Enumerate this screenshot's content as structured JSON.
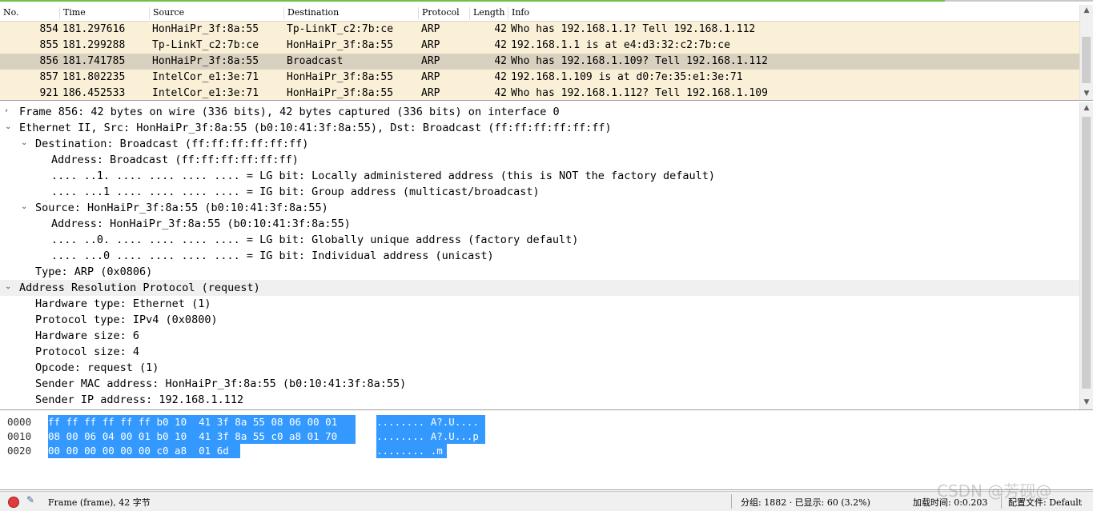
{
  "packet_list": {
    "columns": [
      "No.",
      "Time",
      "Source",
      "Destination",
      "Protocol",
      "Length",
      "Info"
    ],
    "rows": [
      {
        "no": "854",
        "time": "181.297616",
        "src": "HonHaiPr_3f:8a:55",
        "dst": "Tp-LinkT_c2:7b:ce",
        "proto": "ARP",
        "len": "42",
        "info": "Who has 192.168.1.1? Tell 192.168.1.112",
        "selected": false
      },
      {
        "no": "855",
        "time": "181.299288",
        "src": "Tp-LinkT_c2:7b:ce",
        "dst": "HonHaiPr_3f:8a:55",
        "proto": "ARP",
        "len": "42",
        "info": "192.168.1.1 is at e4:d3:32:c2:7b:ce",
        "selected": false
      },
      {
        "no": "856",
        "time": "181.741785",
        "src": "HonHaiPr_3f:8a:55",
        "dst": "Broadcast",
        "proto": "ARP",
        "len": "42",
        "info": "Who has 192.168.1.109? Tell 192.168.1.112",
        "selected": true
      },
      {
        "no": "857",
        "time": "181.802235",
        "src": "IntelCor_e1:3e:71",
        "dst": "HonHaiPr_3f:8a:55",
        "proto": "ARP",
        "len": "42",
        "info": "192.168.1.109 is at d0:7e:35:e1:3e:71",
        "selected": false
      },
      {
        "no": "921",
        "time": "186.452533",
        "src": "IntelCor_e1:3e:71",
        "dst": "HonHaiPr_3f:8a:55",
        "proto": "ARP",
        "len": "42",
        "info": "Who has 192.168.1.112? Tell 192.168.1.109",
        "selected": false
      }
    ]
  },
  "details": [
    {
      "indent": 0,
      "toggle": "collapsed",
      "text": "Frame 856: 42 bytes on wire (336 bits), 42 bytes captured (336 bits) on interface 0",
      "highlight": false
    },
    {
      "indent": 0,
      "toggle": "expanded",
      "text": "Ethernet II, Src: HonHaiPr_3f:8a:55 (b0:10:41:3f:8a:55), Dst: Broadcast (ff:ff:ff:ff:ff:ff)",
      "highlight": false
    },
    {
      "indent": 1,
      "toggle": "expanded",
      "text": "Destination: Broadcast (ff:ff:ff:ff:ff:ff)",
      "highlight": false
    },
    {
      "indent": 2,
      "toggle": "none",
      "text": "Address: Broadcast (ff:ff:ff:ff:ff:ff)",
      "highlight": false
    },
    {
      "indent": 2,
      "toggle": "none",
      "text": ".... ..1. .... .... .... .... = LG bit: Locally administered address (this is NOT the factory default)",
      "highlight": false
    },
    {
      "indent": 2,
      "toggle": "none",
      "text": ".... ...1 .... .... .... .... = IG bit: Group address (multicast/broadcast)",
      "highlight": false
    },
    {
      "indent": 1,
      "toggle": "expanded",
      "text": "Source: HonHaiPr_3f:8a:55 (b0:10:41:3f:8a:55)",
      "highlight": false
    },
    {
      "indent": 2,
      "toggle": "none",
      "text": "Address: HonHaiPr_3f:8a:55 (b0:10:41:3f:8a:55)",
      "highlight": false
    },
    {
      "indent": 2,
      "toggle": "none",
      "text": ".... ..0. .... .... .... .... = LG bit: Globally unique address (factory default)",
      "highlight": false
    },
    {
      "indent": 2,
      "toggle": "none",
      "text": ".... ...0 .... .... .... .... = IG bit: Individual address (unicast)",
      "highlight": false
    },
    {
      "indent": 1,
      "toggle": "none",
      "text": "Type: ARP (0x0806)",
      "highlight": false
    },
    {
      "indent": 0,
      "toggle": "expanded",
      "text": "Address Resolution Protocol (request)",
      "highlight": true
    },
    {
      "indent": 1,
      "toggle": "none",
      "text": "Hardware type: Ethernet (1)",
      "highlight": false
    },
    {
      "indent": 1,
      "toggle": "none",
      "text": "Protocol type: IPv4 (0x0800)",
      "highlight": false
    },
    {
      "indent": 1,
      "toggle": "none",
      "text": "Hardware size: 6",
      "highlight": false
    },
    {
      "indent": 1,
      "toggle": "none",
      "text": "Protocol size: 4",
      "highlight": false
    },
    {
      "indent": 1,
      "toggle": "none",
      "text": "Opcode: request (1)",
      "highlight": false
    },
    {
      "indent": 1,
      "toggle": "none",
      "text": "Sender MAC address: HonHaiPr_3f:8a:55 (b0:10:41:3f:8a:55)",
      "highlight": false
    },
    {
      "indent": 1,
      "toggle": "none",
      "text": "Sender IP address: 192.168.1.112",
      "highlight": false
    }
  ],
  "bytes": [
    {
      "offset": "0000",
      "hex": "ff ff ff ff ff ff b0 10  41 3f 8a 55 08 06 00 01",
      "ascii": "........ A?.U...."
    },
    {
      "offset": "0010",
      "hex": "08 00 06 04 00 01 b0 10  41 3f 8a 55 c0 a8 01 70",
      "ascii": "........ A?.U...p"
    },
    {
      "offset": "0020",
      "hex": "00 00 00 00 00 00 c0 a8  01 6d",
      "ascii": "........ .m"
    }
  ],
  "status": {
    "frame_label": "Frame (frame), 42 字节",
    "packets": "分组: 1882 · 已显示: 60 (3.2%)",
    "load_time": "加载时间: 0:0.203",
    "profile": "配置文件: Default",
    "watermark": "CSDN @芳砚@"
  },
  "icons": {
    "expanded": "expanded-arrow-icon",
    "collapsed": "collapsed-arrow-icon"
  }
}
